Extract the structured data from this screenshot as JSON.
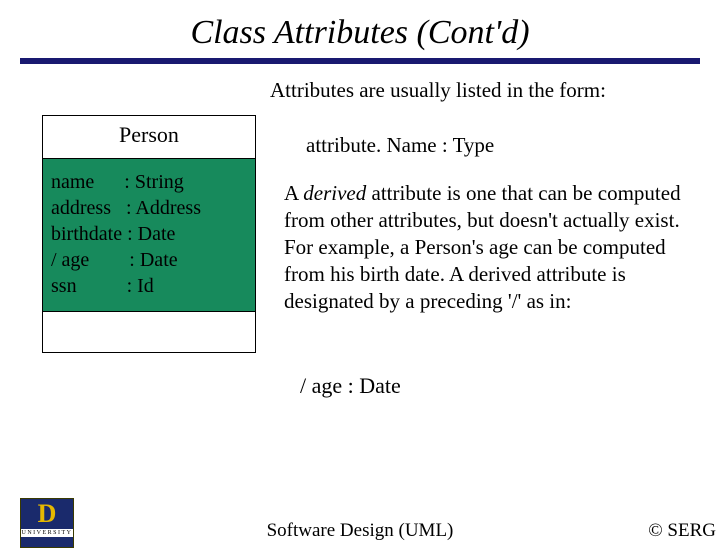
{
  "title": "Class Attributes (Cont'd)",
  "intro": "Attributes are usually listed in the form:",
  "uml": {
    "class_name": "Person",
    "attrs": {
      "l1": "name      : String",
      "l2": "address   : Address",
      "l3": "birthdate : Date",
      "l4": "/ age        : Date",
      "l5": "ssn          : Id"
    }
  },
  "form_line": "attribute. Name : Type",
  "para": {
    "a1": "A ",
    "derived": "derived",
    "a2": " attribute is one that can be computed from other attributes, but doesn't actually exist. For example, a Person's age can be computed from his birth date. A derived attribute is designated by a preceding '/' as in:"
  },
  "example": "/ age : Date",
  "footer_center": "Software Design (UML)",
  "footer_right": "© SERG",
  "logo": {
    "d": "D",
    "u": "UNIVERSITY"
  }
}
